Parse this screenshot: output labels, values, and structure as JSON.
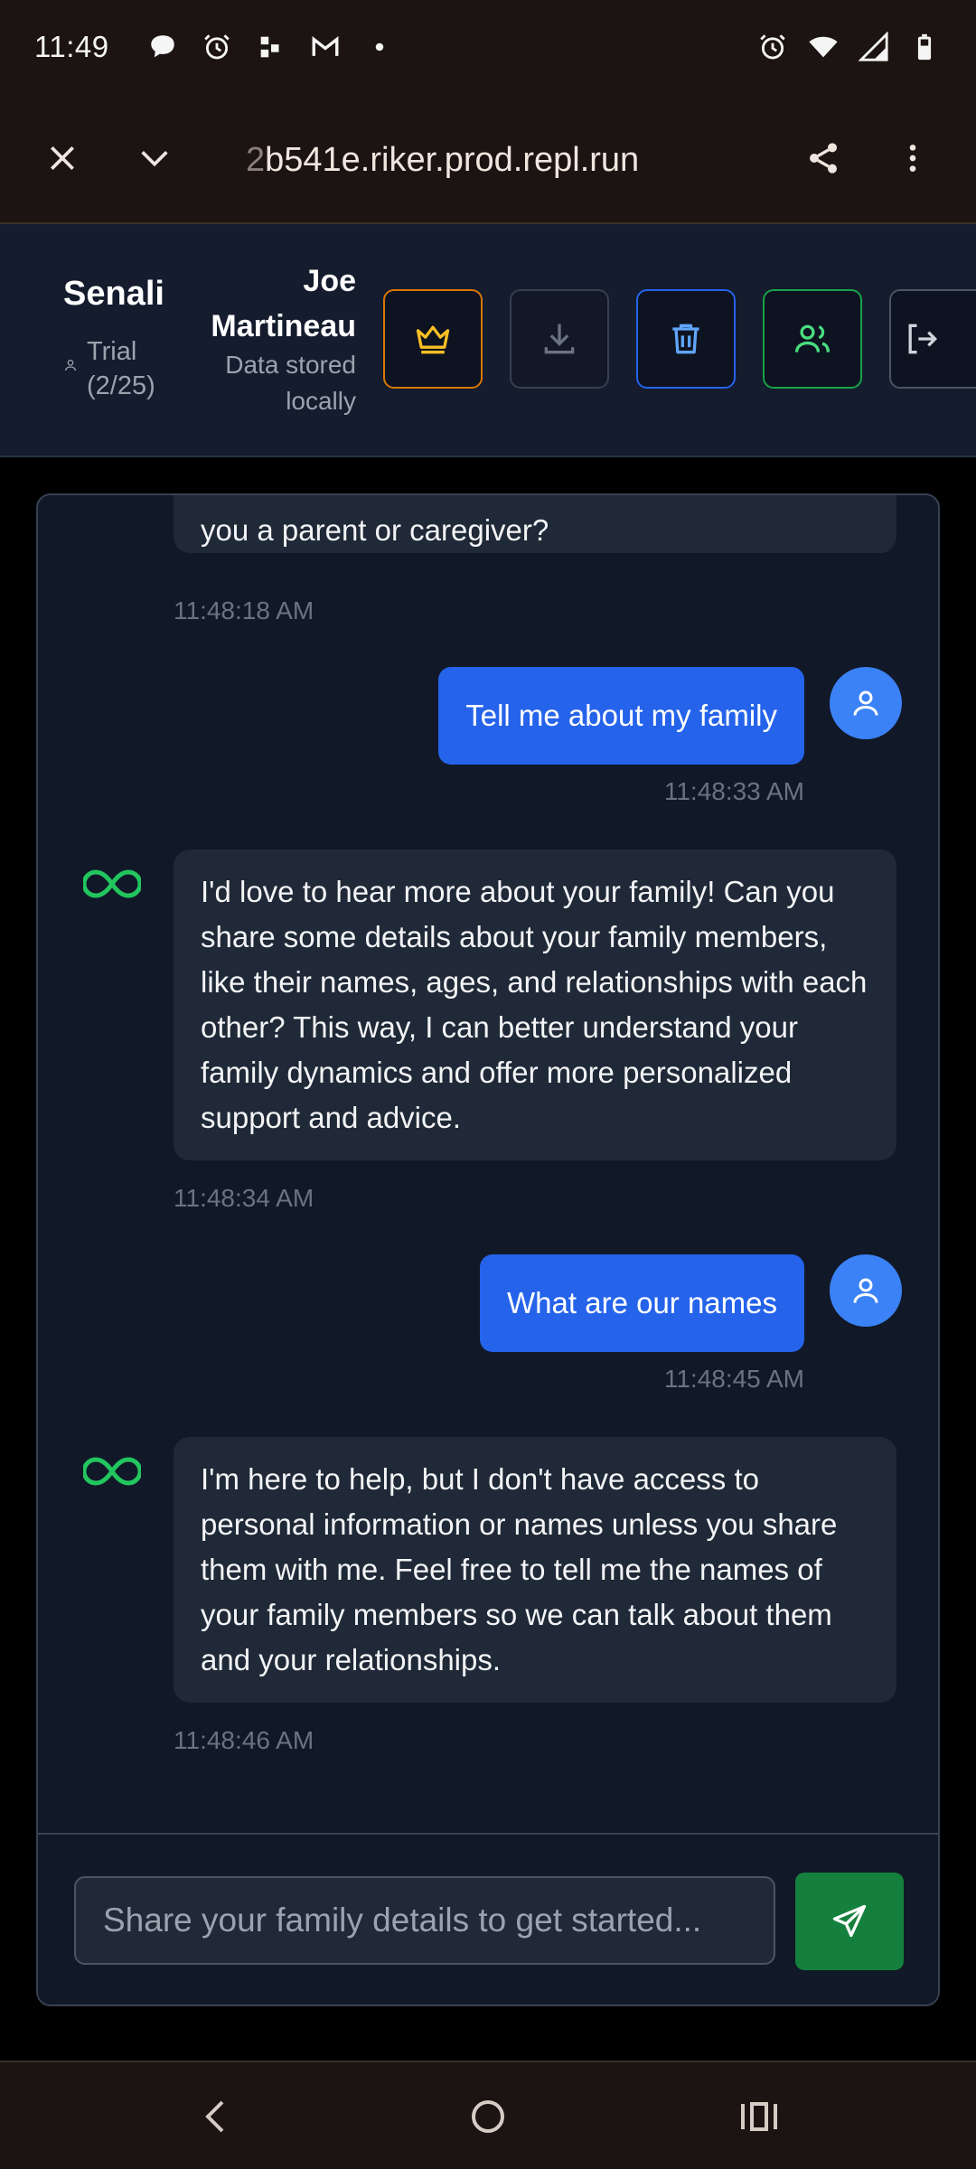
{
  "status_bar": {
    "time": "11:49"
  },
  "browser": {
    "url_prefix": "2",
    "url_rest": "b541e.riker.prod.repl.run"
  },
  "header": {
    "app_name": "Senali",
    "trial_line1": "Trial",
    "trial_line2": "(2/25)",
    "user_first": "Joe",
    "user_last": "Martineau",
    "storage_line1": "Data stored",
    "storage_line2": "locally",
    "colors": {
      "crown": "#d97706",
      "trash": "#2563eb",
      "users": "#16a34a"
    }
  },
  "messages": [
    {
      "role": "assistant",
      "text": "you a parent or caregiver?",
      "time": "11:48:18 AM"
    },
    {
      "role": "user",
      "text": "Tell me about my family",
      "time": "11:48:33 AM"
    },
    {
      "role": "assistant",
      "text": "I'd love to hear more about your family! Can you share some details about your family members, like their names, ages, and relationships with each other? This way, I can better understand your family dynamics and offer more personalized support and advice.",
      "time": "11:48:34 AM"
    },
    {
      "role": "user",
      "text": "What are our names",
      "time": "11:48:45 AM"
    },
    {
      "role": "assistant",
      "text": "I'm here to help, but I don't have access to personal information or names unless you share them with me. Feel free to tell me the names of your family members so we can talk about them and your relationships.",
      "time": "11:48:46 AM"
    }
  ],
  "input": {
    "placeholder": "Share your family details to get started..."
  },
  "colors": {
    "user_bubble": "#2563eb",
    "ai_bubble": "#1f2937",
    "send_button": "#15803d",
    "ai_icon": "#22c55e"
  }
}
